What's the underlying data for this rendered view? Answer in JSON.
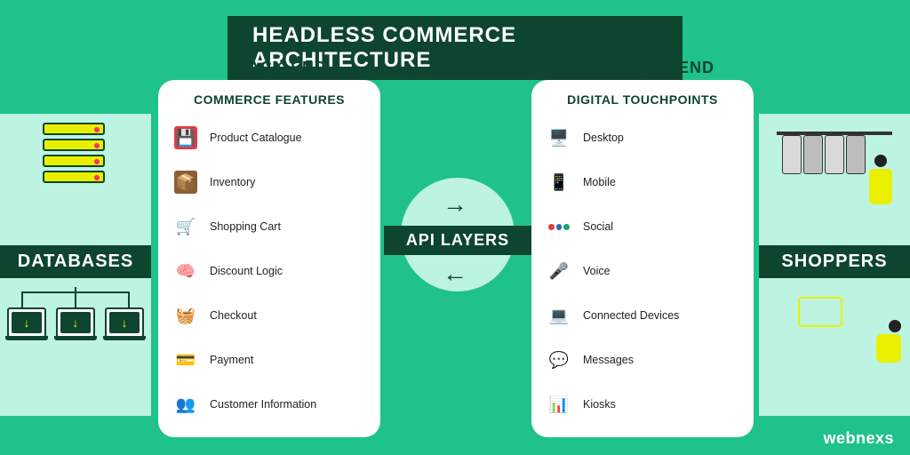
{
  "title": "HEADLESS COMMERCE ARCHITECTURE",
  "sections": {
    "back": "BACK END",
    "front": "FRONT END"
  },
  "side": {
    "left": "DATABASES",
    "right": "SHOPPERS"
  },
  "center": "API LAYERS",
  "brand": "webnexs",
  "backend": {
    "heading": "COMMERCE FEATURES",
    "items": [
      {
        "label": "Product Catalogue",
        "icon": "catalogue-icon"
      },
      {
        "label": "Inventory",
        "icon": "inventory-icon"
      },
      {
        "label": "Shopping Cart",
        "icon": "cart-icon"
      },
      {
        "label": "Discount Logic",
        "icon": "discount-icon"
      },
      {
        "label": "Checkout",
        "icon": "checkout-icon"
      },
      {
        "label": "Payment",
        "icon": "payment-icon"
      },
      {
        "label": "Customer Information",
        "icon": "customer-icon"
      }
    ]
  },
  "frontend": {
    "heading": "DIGITAL TOUCHPOINTS",
    "items": [
      {
        "label": "Desktop",
        "icon": "desktop-icon"
      },
      {
        "label": "Mobile",
        "icon": "mobile-icon"
      },
      {
        "label": "Social",
        "icon": "social-icon"
      },
      {
        "label": "Voice",
        "icon": "voice-icon"
      },
      {
        "label": "Connected Devices",
        "icon": "connected-devices-icon"
      },
      {
        "label": "Messages",
        "icon": "messages-icon"
      },
      {
        "label": "Kiosks",
        "icon": "kiosks-icon"
      }
    ]
  },
  "arrows": {
    "right": "→",
    "left": "←"
  },
  "colors": {
    "bg": "#1fc28a",
    "dark": "#0d452e",
    "light": "#bdf3e1",
    "accent": "#e8f000"
  }
}
